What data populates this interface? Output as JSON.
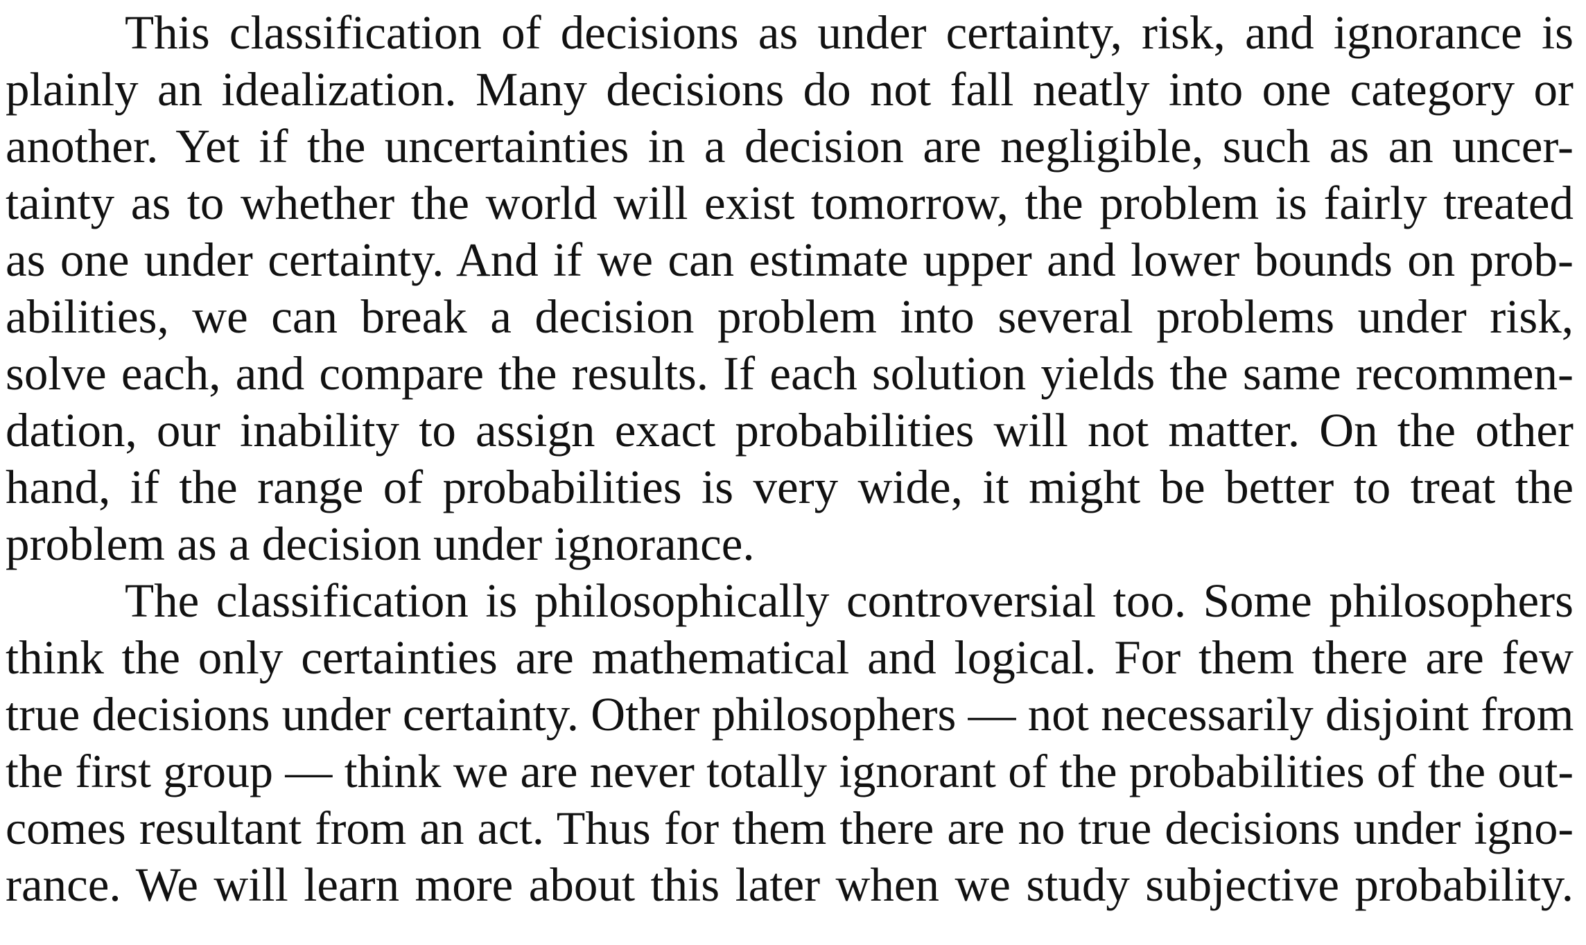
{
  "document": {
    "paragraphs": [
      {
        "lines": [
          "This classification of decisions as under certainty, risk, and ignorance is",
          "plainly an idealization. Many decisions do not fall neatly into one category or",
          "another. Yet if the uncertainties in a decision are negligible, such as an uncer-",
          "tainty as to whether the world will exist tomorrow, the problem is fairly treated",
          "as one under certainty. And if we can estimate upper and lower bounds on prob-",
          "abilities, we can break a decision problem into several problems under risk,",
          "solve each, and compare the results. If each solution yields the same recommen-",
          "dation, our inability to assign exact probabilities will not matter. On the other",
          "hand, if the range of probabilities is very wide, it might be better to treat the",
          "problem as a decision under ignorance."
        ]
      },
      {
        "lines": [
          "The classification is philosophically controversial too. Some philosophers",
          "think the only certainties are mathematical and logical. For them there are few",
          "true decisions under certainty. Other philosophers — not necessarily disjoint from",
          "the first group — think we are never totally ignorant of the probabilities of the out-",
          "comes resultant from an act. Thus for them there are no true decisions under igno-",
          "rance. We will learn more about this later when we study subjective probability."
        ]
      }
    ]
  }
}
